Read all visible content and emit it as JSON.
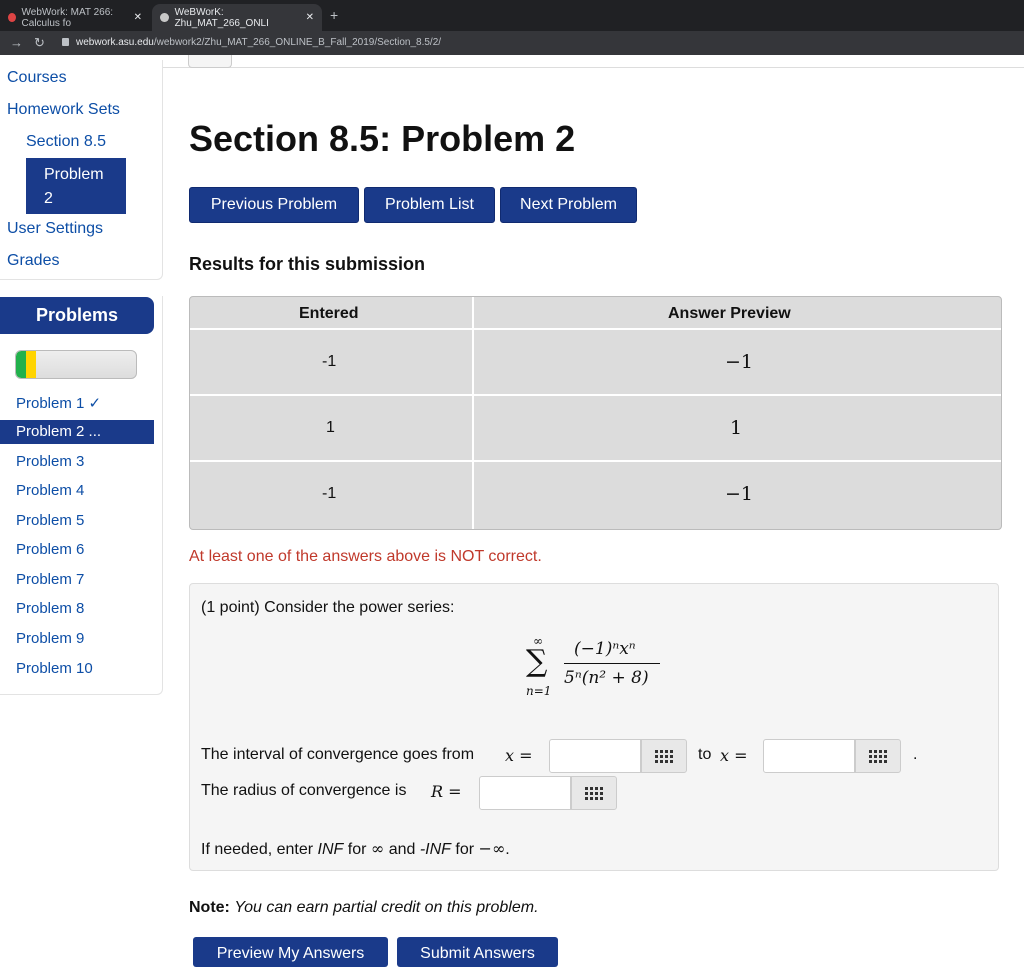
{
  "browser": {
    "tabs": [
      {
        "label": "WebWork: MAT 266: Calculus fo",
        "active": false
      },
      {
        "label": "WeBWorK: Zhu_MAT_266_ONLI",
        "active": true
      }
    ],
    "url_host": "webwork.asu.edu",
    "url_path": "/webwork2/Zhu_MAT_266_ONLINE_B_Fall_2019/Section_8.5/2/"
  },
  "sidebar": {
    "courses": "Courses",
    "homework_sets": "Homework Sets",
    "section": "Section 8.5",
    "problem_line1": "Problem",
    "problem_line2": "2",
    "user_settings": "User Settings",
    "grades": "Grades"
  },
  "problems_panel": {
    "title": "Problems",
    "progress": {
      "correct_fraction": 0.083,
      "incorrect_fraction": 0.083
    },
    "items": [
      "Problem 1 ✓",
      "Problem 2 ...",
      "Problem 3",
      "Problem 4",
      "Problem 5",
      "Problem 6",
      "Problem 7",
      "Problem 8",
      "Problem 9",
      "Problem 10"
    ],
    "active_index": 1
  },
  "main": {
    "title": "Section 8.5: Problem 2",
    "buttons": {
      "previous": "Previous Problem",
      "list": "Problem List",
      "next": "Next Problem"
    },
    "results_heading": "Results for this submission",
    "results_table": {
      "headers": [
        "Entered",
        "Answer Preview"
      ],
      "rows": [
        {
          "entered": "-1",
          "preview": "−1"
        },
        {
          "entered": "1",
          "preview": "1"
        },
        {
          "entered": "-1",
          "preview": "−1"
        }
      ]
    },
    "warning": "At least one of the answers above is NOT correct.",
    "problem": {
      "intro": "(1 point) Consider the power series:",
      "series": {
        "upper": "∞",
        "lower": "n=1",
        "numerator": "(−1)ⁿxⁿ",
        "denominator": "5ⁿ(n² + 8)"
      },
      "interval_text": "The interval of convergence goes from",
      "x_eq": "x =",
      "to_text": "to",
      "period": ".",
      "radius_text": "The radius of convergence is",
      "r_eq": "R =",
      "hint_prefix": "If needed, enter",
      "hint_inf": "INF",
      "hint_for": "for",
      "hint_infinity": "∞",
      "hint_and": "and",
      "hint_neginf": "-INF",
      "hint_for2": "for",
      "hint_neg_infinity": "−∞",
      "hint_end": "."
    },
    "note_label": "Note:",
    "note_text": "You can earn partial credit on this problem.",
    "preview_button": "Preview My Answers",
    "submit_button": "Submit Answers"
  },
  "colors": {
    "nav_blue": "#1a3a8a",
    "link_blue": "#0d4ea6",
    "warning_red": "#c0392b"
  }
}
